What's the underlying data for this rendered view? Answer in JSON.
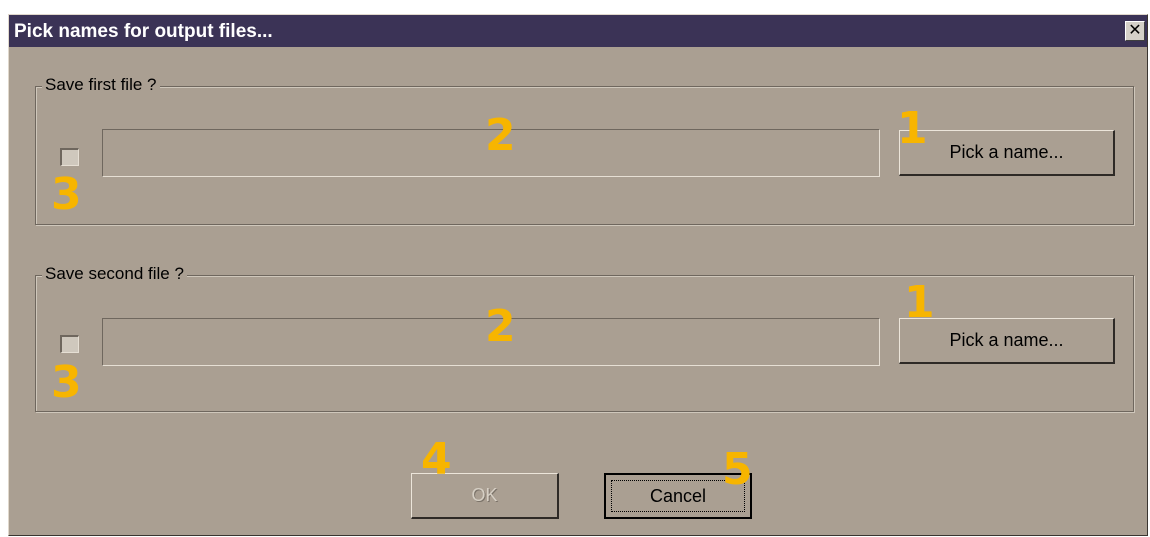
{
  "dialog": {
    "title": "Pick names for output files...",
    "close_glyph": "✕"
  },
  "groups": [
    {
      "label": "Save first file ?",
      "filename_value": "",
      "checked": false,
      "pick_button_label": "Pick a name..."
    },
    {
      "label": "Save second file ?",
      "filename_value": "",
      "checked": false,
      "pick_button_label": "Pick a name..."
    }
  ],
  "buttons": {
    "ok_label": "OK",
    "ok_enabled": false,
    "cancel_label": "Cancel"
  },
  "markers": {
    "pick_button": "1",
    "filename_field": "2",
    "checkbox": "3",
    "ok_button": "4",
    "cancel_button": "5"
  },
  "colors": {
    "marker": "#f7b500",
    "titlebar": "#3b3356",
    "dialog_background": "#aa9f92"
  }
}
